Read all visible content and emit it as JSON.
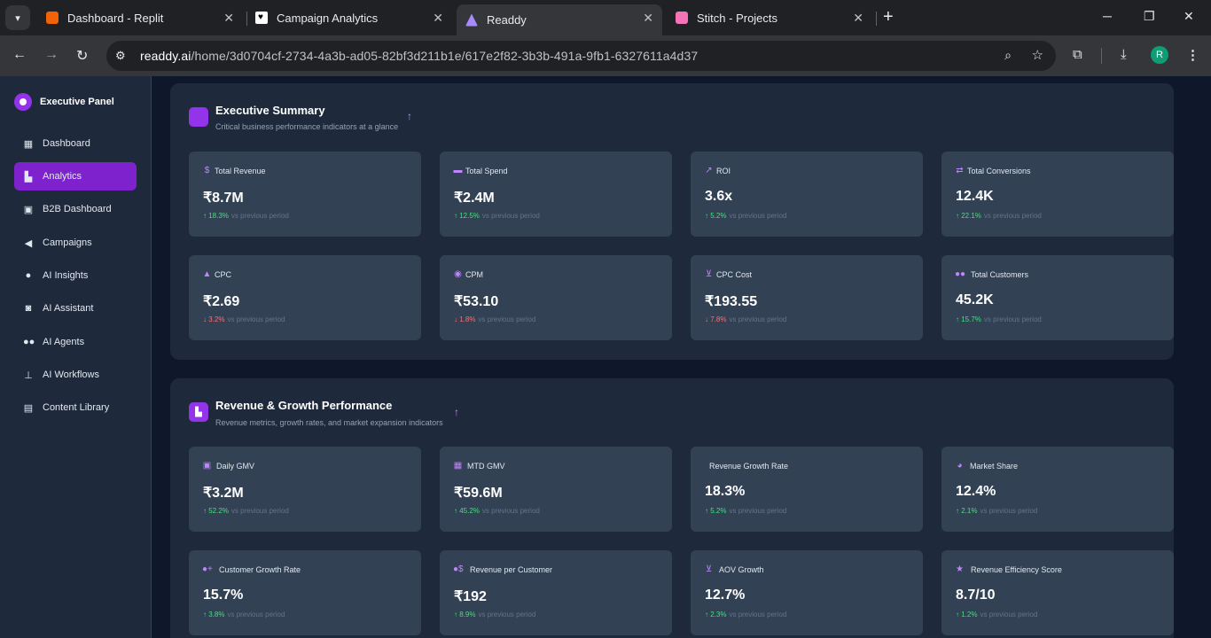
{
  "browser": {
    "tabs": [
      {
        "title": "Dashboard - Replit",
        "favicon_color": "#f26207"
      },
      {
        "title": "Campaign Analytics",
        "favicon_color": "#ffffff"
      },
      {
        "title": "Readdy",
        "favicon_color": "#a78bfa"
      },
      {
        "title": "Stitch - Projects",
        "favicon_color": "#f472b6"
      }
    ],
    "active_tab": 2,
    "url_domain": "readdy.ai",
    "url_path": "/home/3d0704cf-2734-4a3b-ad05-82bf3d211b1e/617e2f82-3b3b-491a-9fb1-6327611a4d37",
    "profile_initial": "R"
  },
  "sidebar": {
    "brand": "Executive Panel",
    "items": [
      {
        "label": "Dashboard",
        "icon": "grid-icon"
      },
      {
        "label": "Analytics",
        "icon": "chart-icon"
      },
      {
        "label": "B2B Dashboard",
        "icon": "briefcase-icon"
      },
      {
        "label": "Campaigns",
        "icon": "megaphone-icon"
      },
      {
        "label": "AI Insights",
        "icon": "lightbulb-icon"
      },
      {
        "label": "AI Assistant",
        "icon": "robot-icon"
      },
      {
        "label": "AI Agents",
        "icon": "users-icon"
      },
      {
        "label": "AI Workflows",
        "icon": "sitemap-icon"
      },
      {
        "label": "Content Library",
        "icon": "book-icon"
      }
    ],
    "active_index": 1
  },
  "sections": [
    {
      "title": "Executive Summary",
      "subtitle": "Critical business performance indicators at a glance",
      "cards": [
        {
          "label": "Total Revenue",
          "value": "₹8.7M",
          "change": "18.3%",
          "direction": "up",
          "icon": "dollar-icon"
        },
        {
          "label": "Total Spend",
          "value": "₹2.4M",
          "change": "12.5%",
          "direction": "up",
          "icon": "credit-card-icon"
        },
        {
          "label": "ROI",
          "value": "3.6x",
          "change": "5.2%",
          "direction": "up",
          "icon": "line-chart-icon"
        },
        {
          "label": "Total Conversions",
          "value": "12.4K",
          "change": "22.1%",
          "direction": "up",
          "icon": "exchange-icon"
        },
        {
          "label": "CPC",
          "value": "₹2.69",
          "change": "3.2%",
          "direction": "down",
          "icon": "cursor-icon"
        },
        {
          "label": "CPM",
          "value": "₹53.10",
          "change": "1.8%",
          "direction": "down",
          "icon": "eye-icon"
        },
        {
          "label": "CPC Cost",
          "value": "₹193.55",
          "change": "7.8%",
          "direction": "down",
          "icon": "cart-icon"
        },
        {
          "label": "Total Customers",
          "value": "45.2K",
          "change": "15.7%",
          "direction": "up",
          "icon": "users-icon"
        }
      ]
    },
    {
      "title": "Revenue & Growth Performance",
      "subtitle": "Revenue metrics, growth rates, and market expansion indicators",
      "cards": [
        {
          "label": "Daily GMV",
          "value": "₹3.2M",
          "change": "52.2%",
          "direction": "up",
          "icon": "calendar-day-icon"
        },
        {
          "label": "MTD GMV",
          "value": "₹59.6M",
          "change": "45.2%",
          "direction": "up",
          "icon": "calendar-icon"
        },
        {
          "label": "Revenue Growth Rate",
          "value": "18.3%",
          "change": "5.2%",
          "direction": "up",
          "icon": ""
        },
        {
          "label": "Market Share",
          "value": "12.4%",
          "change": "2.1%",
          "direction": "up",
          "icon": "pie-chart-icon"
        },
        {
          "label": "Customer Growth Rate",
          "value": "15.7%",
          "change": "3.8%",
          "direction": "up",
          "icon": "user-plus-icon"
        },
        {
          "label": "Revenue per Customer",
          "value": "₹192",
          "change": "8.9%",
          "direction": "up",
          "icon": "user-dollar-icon"
        },
        {
          "label": "AOV Growth",
          "value": "12.7%",
          "change": "2.3%",
          "direction": "up",
          "icon": "basket-icon"
        },
        {
          "label": "Revenue Efficiency Score",
          "value": "8.7/10",
          "change": "1.2%",
          "direction": "up",
          "icon": "star-icon"
        }
      ]
    }
  ],
  "comparison_text": "vs previous period",
  "colors": {
    "accent": "#9333ea",
    "up": "#4ade80",
    "down": "#f87171",
    "card": "#334155",
    "panel": "#1e293b"
  }
}
